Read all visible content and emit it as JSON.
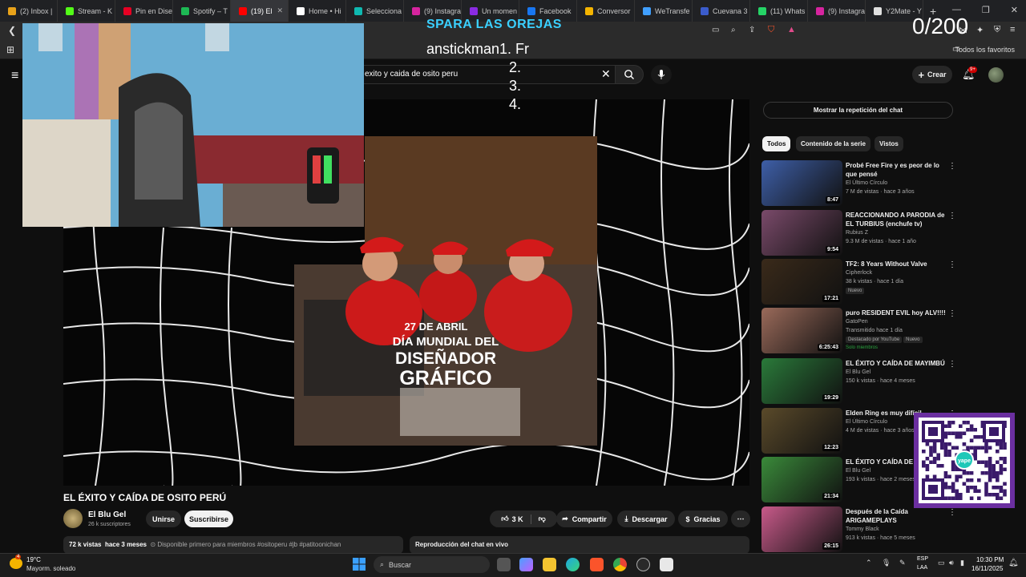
{
  "browser": {
    "tabs": [
      {
        "label": "(2) Inbox |",
        "color": "#e8a21a"
      },
      {
        "label": "Stream - K",
        "color": "#53fc18"
      },
      {
        "label": "Pin en Dise",
        "color": "#e60023"
      },
      {
        "label": "Spotify – T",
        "color": "#1db954"
      },
      {
        "label": "(19) El",
        "color": "#ff0000",
        "active": true
      },
      {
        "label": "Home • Hi",
        "color": "#ffffff"
      },
      {
        "label": "Selecciona",
        "color": "#0fb9b1"
      },
      {
        "label": "(9) Instagra",
        "color": "#d6249f"
      },
      {
        "label": "Un momen",
        "color": "#8a2be2"
      },
      {
        "label": "Facebook",
        "color": "#1877f2"
      },
      {
        "label": "Conversor",
        "color": "#f4b400"
      },
      {
        "label": "WeTransfe",
        "color": "#409fff"
      },
      {
        "label": "Cuevana 3",
        "color": "#3b5ccc"
      },
      {
        "label": "(11) Whats",
        "color": "#25d366"
      },
      {
        "label": "(9) Instagra",
        "color": "#d6249f"
      },
      {
        "label": "Y2Mate - Y",
        "color": "#e0e0e0"
      }
    ],
    "new_tab_icon": "+",
    "favorites_label": "Todos los favoritos"
  },
  "overlay": {
    "title": "SPARA LAS OREJAS",
    "list_first": "anstickman1. Fr",
    "list_rest": [
      "2.",
      "3.",
      "4."
    ],
    "counter": "0/200"
  },
  "youtube": {
    "search_query": "exito y caida de osito peru",
    "create_label": "Crear",
    "notif_badge": "9+",
    "video": {
      "overlay_text_date": "27 DE ABRIL",
      "overlay_text_line1": "DÍA MUNDIAL DEL",
      "overlay_text_line2": "DISEÑADOR",
      "overlay_text_line3": "GRÁFICO",
      "title": "EL ÉXITO Y CAÍDA DE OSITO PERÚ",
      "channel": "El Blu Gel",
      "subscribers": "26 k suscriptores",
      "join_label": "Unirse",
      "subscribe_label": "Suscribirse",
      "likes": "3 K",
      "share_label": "Compartir",
      "download_label": "Descargar",
      "thanks_label": "Gracias",
      "views": "72 k vistas",
      "date": "hace 3 meses",
      "description_tags": "⊙ Disponible primero para miembros #ositoperu #jb #patitoonichan",
      "chat_replay_label": "Reproducción del chat en vivo"
    },
    "sidebar": {
      "show_chat_label": "Mostrar la repetición del chat",
      "chips": [
        "Todos",
        "Contenido de la serie",
        "Vistos"
      ],
      "recommendations": [
        {
          "title": "Probé Free Fire y es peor de lo que pensé",
          "channel": "El Último Círculo",
          "meta": "7 M de vistas · hace 3 años",
          "duration": "8:47",
          "thumb_color": "#3e5fa8"
        },
        {
          "title": "REACCIONANDO A PARODIA de EL TURBIUS (enchufe tv)",
          "channel": "Rubius Z",
          "meta": "9.3 M de vistas · hace 1 año",
          "duration": "9:54",
          "thumb_color": "#7a4a6a"
        },
        {
          "title": "TF2: 8 Years Without Valve",
          "channel": "Cipherlock",
          "meta": "38 k vistas · hace 1 día",
          "duration": "17:21",
          "badge": "Nuevo",
          "thumb_color": "#3a2a1a"
        },
        {
          "title": "puro RESIDENT EVIL hoy ALV!!!!",
          "channel": "GatoPen",
          "meta": "Transmitido hace 1 día",
          "duration": "6:25:43",
          "badges": [
            "Destacado por YouTube",
            "Nuevo"
          ],
          "members": "Solo miembros",
          "thumb_color": "#9a6a5a"
        },
        {
          "title": "EL ÉXITO Y CAÍDA DE MAYIMBÚ",
          "channel": "El Blu Gel",
          "meta": "150 k vistas · hace 4 meses",
          "duration": "19:29",
          "thumb_color": "#2a7a3a"
        },
        {
          "title": "Elden Ring es muy difícil",
          "channel": "El Último Círculo",
          "meta": "4 M de vistas · hace 3 años",
          "duration": "12:23",
          "thumb_color": "#5a4a2a"
        },
        {
          "title": "EL ÉXITO Y CAÍDA DE DOMINGO",
          "channel": "El Blu Gel",
          "meta": "193 k vistas · hace 2 meses",
          "duration": "21:34",
          "thumb_color": "#3a8a3a"
        },
        {
          "title": "Después de la Caída ARIGAMEPLAYS",
          "channel": "Tommy Black",
          "meta": "913 k vistas · hace 5 meses",
          "duration": "26:15",
          "thumb_color": "#c85a8a"
        }
      ]
    }
  },
  "taskbar": {
    "temperature": "19°C",
    "weather_desc": "Mayorm. soleado",
    "weather_badge": "4",
    "search_label": "Buscar",
    "lang1": "ESP",
    "lang2": "LAA",
    "time": "10:30 PM",
    "date": "16/11/2025"
  },
  "qr_label": "yape"
}
